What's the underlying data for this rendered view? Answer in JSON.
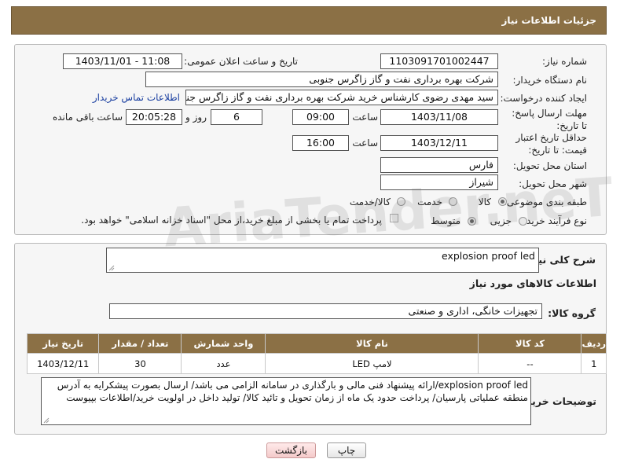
{
  "header": {
    "title": "جزئیات اطلاعات نیاز"
  },
  "form": {
    "need_number_label": "شماره نیاز:",
    "need_number": "1103091701002447",
    "announce_label": "تاریخ و ساعت اعلان عمومی:",
    "announce_value": "1403/11/01 - 11:08",
    "buyer_org_label": "نام دستگاه خریدار:",
    "buyer_org": "شرکت بهره برداری نفت و گاز زاگرس جنوبی",
    "creator_label": "ایجاد کننده درخواست:",
    "creator": "سید مهدی رضوی کارشناس خرید شرکت بهره برداری نفت و گاز زاگرس جنوبی",
    "contact_link": "اطلاعات تماس خریدار",
    "reply_deadline_label": "مهلت ارسال پاسخ: تا تاریخ:",
    "reply_date": "1403/11/08",
    "time_label": "ساعت",
    "reply_time": "09:00",
    "days_value": "6",
    "days_label": "روز و",
    "remaining_time": "20:05:28",
    "remaining_label": "ساعت باقی مانده",
    "price_validity_label": "حداقل تاریخ اعتبار قیمت: تا تاریخ:",
    "price_date": "1403/12/11",
    "price_time": "16:00",
    "province_label": "استان محل تحویل:",
    "province": "فارس",
    "city_label": "شهر محل تحویل:",
    "city": "شیراز",
    "category_label": "طبقه بندی موضوعی:",
    "category_options": [
      "کالا",
      "خدمت",
      "کالا/خدمت"
    ],
    "process_label": "نوع فرآیند خرید :",
    "process_options": [
      "جزیی",
      "متوسط"
    ],
    "payment_note": "پرداخت تمام یا بخشی از مبلغ خرید،از محل \"اسناد خزانه اسلامی\" خواهد بود."
  },
  "description": {
    "label": "شرح کلی نیاز:",
    "value": "explosion proof led",
    "goods_info_title": "اطلاعات کالاهای مورد نیاز",
    "group_label": "گروه کالا:",
    "group_value": "تجهیزات خانگی، اداری و صنعتی"
  },
  "table": {
    "headers": [
      "ردیف",
      "کد کالا",
      "نام کالا",
      "واحد شمارش",
      "تعداد / مقدار",
      "تاریخ نیاز"
    ],
    "rows": [
      [
        "1",
        "--",
        "لامپ LED",
        "عدد",
        "30",
        "1403/12/11"
      ]
    ]
  },
  "notes": {
    "label": "توضیحات خریدار:",
    "value": "explosion proof led/ارائه پیشنهاد فنی مالی و بارگذاری در سامانه الزامی می باشد/ ارسال بصورت پیشکرایه به آدرس منطقه عملیاتی پارسیان/ پرداخت حدود یک ماه از زمان تحویل و تائید کالا/ تولید داخل در اولویت خرید/اطلاعات بپیوست"
  },
  "buttons": {
    "print": "چاپ",
    "back": "بازگشت"
  },
  "watermark": {
    "text": "AriaTender.neT"
  }
}
